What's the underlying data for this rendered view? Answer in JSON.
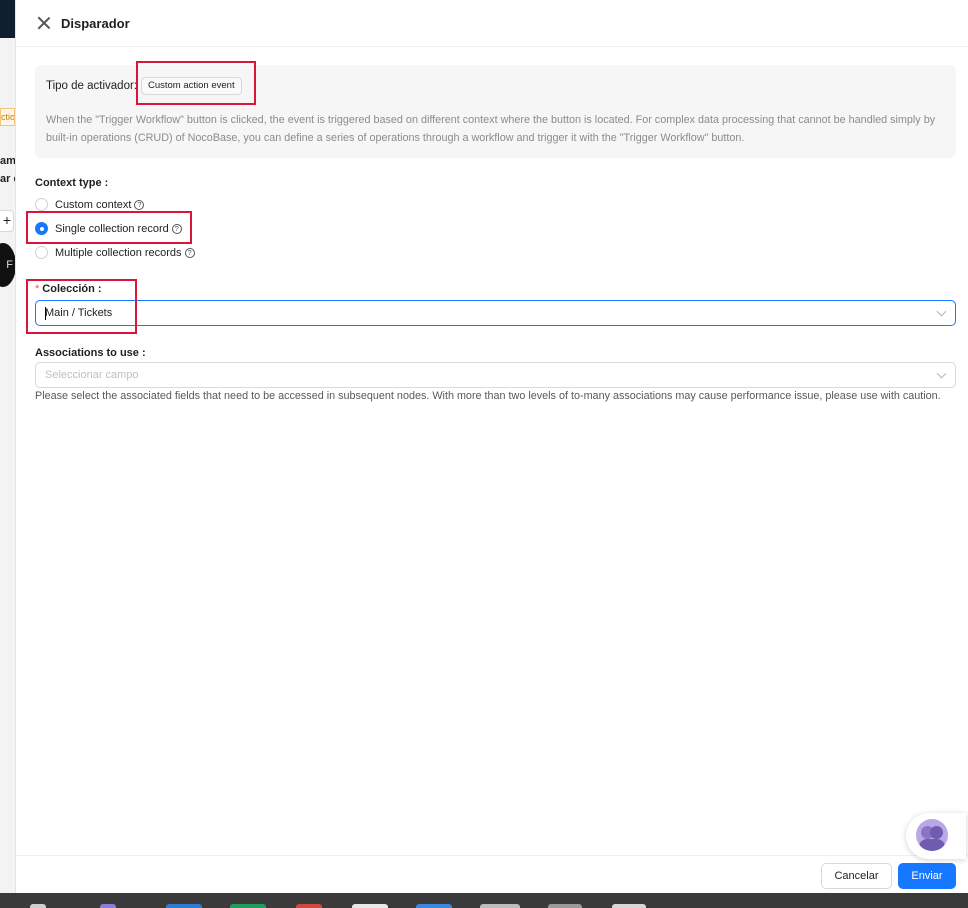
{
  "background": {
    "tag_text": "ction",
    "text1": "ame",
    "text2": "ar e",
    "plus_symbol": "+",
    "avatar_text": "F"
  },
  "drawer": {
    "title": "Disparador",
    "trigger": {
      "label": "Tipo de activador:",
      "tag": "Custom action event",
      "description": "When the \"Trigger Workflow\" button is clicked, the event is triggered based on different context where the button is located. For complex data processing that cannot be handled simply by built-in operations (CRUD) of NocoBase, you can define a series of operations through a workflow and trigger it with the \"Trigger Workflow\" button."
    },
    "context_type": {
      "label": "Context type",
      "options": [
        {
          "label": "Custom context",
          "checked": false
        },
        {
          "label": "Single collection record",
          "checked": true
        },
        {
          "label": "Multiple collection records",
          "checked": false
        }
      ]
    },
    "collection": {
      "required_mark": "*",
      "label": "Colección",
      "value": "Main / Tickets"
    },
    "associations": {
      "label": "Associations to use",
      "placeholder": "Seleccionar campo",
      "help": "Please select the associated fields that need to be accessed in subsequent nodes. With more than two levels of to-many associations may cause performance issue, please use with caution."
    },
    "footer": {
      "cancel_label": "Cancelar",
      "submit_label": "Enviar"
    }
  },
  "icons": {
    "help_glyph": "?"
  },
  "colors": {
    "primary": "#1677ff",
    "annotation": "#d9163a",
    "required": "#ff4d4f"
  }
}
